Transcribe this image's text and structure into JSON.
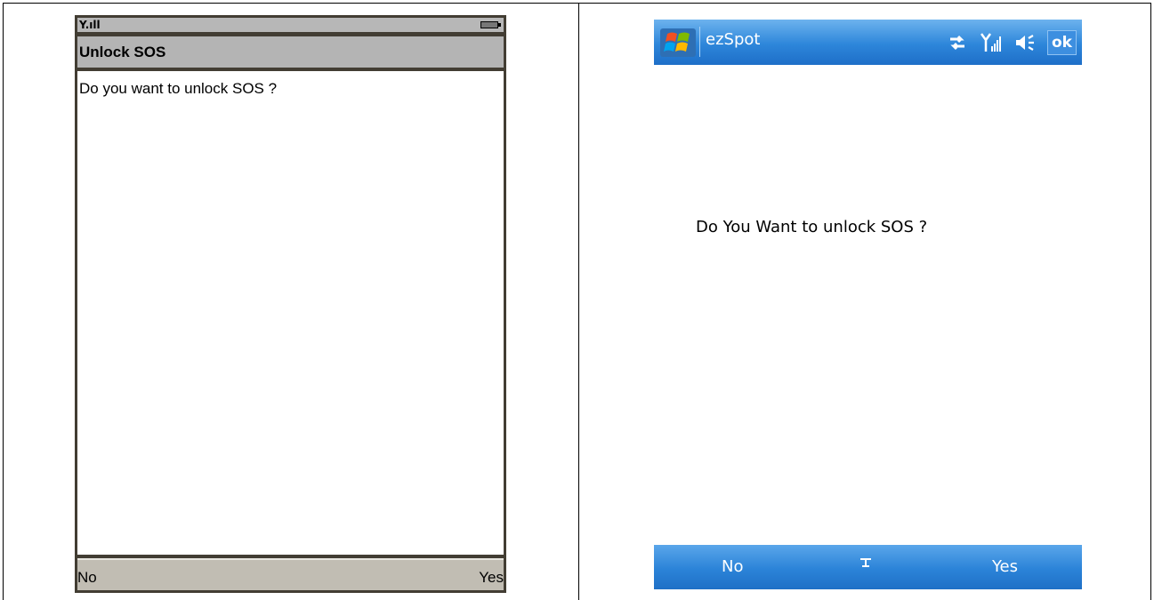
{
  "left_phone": {
    "status_signal": "Y.ıll",
    "title": "Unlock SOS",
    "message": "Do you want to unlock SOS ?",
    "softkey_left": "No",
    "softkey_right": "Yes"
  },
  "right_phone": {
    "app_name": "ezSpot",
    "ok_label": "ok",
    "message": "Do You Want to unlock SOS ?",
    "softkey_left": "No",
    "softkey_right": "Yes",
    "status_icons": [
      "connectivity-icon",
      "signal-icon",
      "speaker-icon"
    ],
    "colors": {
      "title_bar": "#2d86da",
      "menu_bar": "#2b83d8"
    }
  }
}
